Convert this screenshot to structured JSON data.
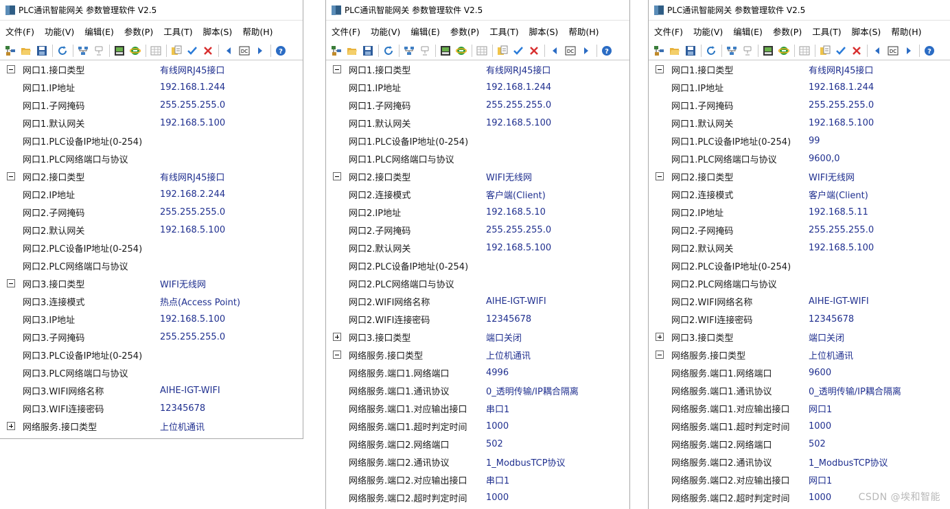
{
  "window_title": "PLC通讯智能网关 参数管理软件 V2.5",
  "menu": [
    "文件(F)",
    "功能(V)",
    "编辑(E)",
    "参数(P)",
    "工具(T)",
    "脚本(S)",
    "帮助(H)"
  ],
  "toolbar_icons": [
    "device-tree-icon",
    "open-folder-icon",
    "save-icon",
    "refresh-icon",
    "network-icon",
    "disconnect-icon",
    "export-icon",
    "ie-icon",
    "grid-icon",
    "copy-icon",
    "check-icon",
    "cross-icon",
    "prev-icon",
    "dc-icon",
    "next-icon",
    "help-icon"
  ],
  "windows": [
    {
      "rows": [
        {
          "toggle": "minus",
          "name": "网口1.接口类型",
          "value": "有线网RJ45接口"
        },
        {
          "toggle": "",
          "name": "网口1.IP地址",
          "value": "192.168.1.244"
        },
        {
          "toggle": "",
          "name": "网口1.子网掩码",
          "value": "255.255.255.0"
        },
        {
          "toggle": "",
          "name": "网口1.默认网关",
          "value": "192.168.5.100"
        },
        {
          "toggle": "",
          "name": "网口1.PLC设备IP地址(0-254)",
          "value": ""
        },
        {
          "toggle": "",
          "name": "网口1.PLC网络端口与协议",
          "value": ""
        },
        {
          "toggle": "minus",
          "name": "网口2.接口类型",
          "value": "有线网RJ45接口"
        },
        {
          "toggle": "",
          "name": "网口2.IP地址",
          "value": "192.168.2.244"
        },
        {
          "toggle": "",
          "name": "网口2.子网掩码",
          "value": "255.255.255.0"
        },
        {
          "toggle": "",
          "name": "网口2.默认网关",
          "value": "192.168.5.100"
        },
        {
          "toggle": "",
          "name": "网口2.PLC设备IP地址(0-254)",
          "value": ""
        },
        {
          "toggle": "",
          "name": "网口2.PLC网络端口与协议",
          "value": ""
        },
        {
          "toggle": "minus",
          "name": "网口3.接口类型",
          "value": "WIFI无线网"
        },
        {
          "toggle": "",
          "name": "网口3.连接模式",
          "value": "热点(Access Point)"
        },
        {
          "toggle": "",
          "name": "网口3.IP地址",
          "value": "192.168.5.100"
        },
        {
          "toggle": "",
          "name": "网口3.子网掩码",
          "value": "255.255.255.0"
        },
        {
          "toggle": "",
          "name": "网口3.PLC设备IP地址(0-254)",
          "value": ""
        },
        {
          "toggle": "",
          "name": "网口3.PLC网络端口与协议",
          "value": ""
        },
        {
          "toggle": "",
          "name": "网口3.WIFI网络名称",
          "value": "AIHE-IGT-WIFI"
        },
        {
          "toggle": "",
          "name": "网口3.WIFI连接密码",
          "value": "12345678"
        },
        {
          "toggle": "plus",
          "name": "网络服务.接口类型",
          "value": "上位机通讯"
        }
      ]
    },
    {
      "rows": [
        {
          "toggle": "minus",
          "name": "网口1.接口类型",
          "value": "有线网RJ45接口"
        },
        {
          "toggle": "",
          "name": "网口1.IP地址",
          "value": "192.168.1.244"
        },
        {
          "toggle": "",
          "name": "网口1.子网掩码",
          "value": "255.255.255.0"
        },
        {
          "toggle": "",
          "name": "网口1.默认网关",
          "value": "192.168.5.100"
        },
        {
          "toggle": "",
          "name": "网口1.PLC设备IP地址(0-254)",
          "value": ""
        },
        {
          "toggle": "",
          "name": "网口1.PLC网络端口与协议",
          "value": ""
        },
        {
          "toggle": "minus",
          "name": "网口2.接口类型",
          "value": "WIFI无线网"
        },
        {
          "toggle": "",
          "name": "网口2.连接模式",
          "value": "客户端(Client)"
        },
        {
          "toggle": "",
          "name": "网口2.IP地址",
          "value": "192.168.5.10"
        },
        {
          "toggle": "",
          "name": "网口2.子网掩码",
          "value": "255.255.255.0"
        },
        {
          "toggle": "",
          "name": "网口2.默认网关",
          "value": "192.168.5.100"
        },
        {
          "toggle": "",
          "name": "网口2.PLC设备IP地址(0-254)",
          "value": ""
        },
        {
          "toggle": "",
          "name": "网口2.PLC网络端口与协议",
          "value": ""
        },
        {
          "toggle": "",
          "name": "网口2.WIFI网络名称",
          "value": "AIHE-IGT-WIFI"
        },
        {
          "toggle": "",
          "name": "网口2.WIFI连接密码",
          "value": "12345678"
        },
        {
          "toggle": "plus",
          "name": "网口3.接口类型",
          "value": "端口关闭"
        },
        {
          "toggle": "minus",
          "name": "网络服务.接口类型",
          "value": "上位机通讯"
        },
        {
          "toggle": "",
          "name": "网络服务.端口1.网络端口",
          "value": "4996"
        },
        {
          "toggle": "",
          "name": "网络服务.端口1.通讯协议",
          "value": "0_透明传输/IP耦合隔离"
        },
        {
          "toggle": "",
          "name": "网络服务.端口1.对应输出接口",
          "value": "串口1"
        },
        {
          "toggle": "",
          "name": "网络服务.端口1.超时判定时间",
          "value": "1000"
        },
        {
          "toggle": "",
          "name": "网络服务.端口2.网络端口",
          "value": "502"
        },
        {
          "toggle": "",
          "name": "网络服务.端口2.通讯协议",
          "value": "1_ModbusTCP协议"
        },
        {
          "toggle": "",
          "name": "网络服务.端口2.对应输出接口",
          "value": "串口1"
        },
        {
          "toggle": "",
          "name": "网络服务.端口2.超时判定时间",
          "value": "1000"
        }
      ]
    },
    {
      "rows": [
        {
          "toggle": "minus",
          "name": "网口1.接口类型",
          "value": "有线网RJ45接口"
        },
        {
          "toggle": "",
          "name": "网口1.IP地址",
          "value": "192.168.1.244"
        },
        {
          "toggle": "",
          "name": "网口1.子网掩码",
          "value": "255.255.255.0"
        },
        {
          "toggle": "",
          "name": "网口1.默认网关",
          "value": "192.168.5.100"
        },
        {
          "toggle": "",
          "name": "网口1.PLC设备IP地址(0-254)",
          "value": "99"
        },
        {
          "toggle": "",
          "name": "网口1.PLC网络端口与协议",
          "value": "9600,0"
        },
        {
          "toggle": "minus",
          "name": "网口2.接口类型",
          "value": "WIFI无线网"
        },
        {
          "toggle": "",
          "name": "网口2.连接模式",
          "value": "客户端(Client)"
        },
        {
          "toggle": "",
          "name": "网口2.IP地址",
          "value": "192.168.5.11"
        },
        {
          "toggle": "",
          "name": "网口2.子网掩码",
          "value": "255.255.255.0"
        },
        {
          "toggle": "",
          "name": "网口2.默认网关",
          "value": "192.168.5.100"
        },
        {
          "toggle": "",
          "name": "网口2.PLC设备IP地址(0-254)",
          "value": ""
        },
        {
          "toggle": "",
          "name": "网口2.PLC网络端口与协议",
          "value": ""
        },
        {
          "toggle": "",
          "name": "网口2.WIFI网络名称",
          "value": "AIHE-IGT-WIFI"
        },
        {
          "toggle": "",
          "name": "网口2.WIFI连接密码",
          "value": "12345678"
        },
        {
          "toggle": "plus",
          "name": "网口3.接口类型",
          "value": "端口关闭"
        },
        {
          "toggle": "minus",
          "name": "网络服务.接口类型",
          "value": "上位机通讯"
        },
        {
          "toggle": "",
          "name": "网络服务.端口1.网络端口",
          "value": "9600"
        },
        {
          "toggle": "",
          "name": "网络服务.端口1.通讯协议",
          "value": "0_透明传输/IP耦合隔离"
        },
        {
          "toggle": "",
          "name": "网络服务.端口1.对应输出接口",
          "value": "网口1"
        },
        {
          "toggle": "",
          "name": "网络服务.端口1.超时判定时间",
          "value": "1000"
        },
        {
          "toggle": "",
          "name": "网络服务.端口2.网络端口",
          "value": "502"
        },
        {
          "toggle": "",
          "name": "网络服务.端口2.通讯协议",
          "value": "1_ModbusTCP协议"
        },
        {
          "toggle": "",
          "name": "网络服务.端口2.对应输出接口",
          "value": "网口1"
        },
        {
          "toggle": "",
          "name": "网络服务.端口2.超时判定时间",
          "value": "1000"
        }
      ]
    }
  ],
  "watermark": "CSDN @埃和智能",
  "colors": {
    "value_text": "#1f2f8f",
    "name_text": "#1a1a1a",
    "check": "#2a7bd8",
    "cross": "#d83030"
  }
}
